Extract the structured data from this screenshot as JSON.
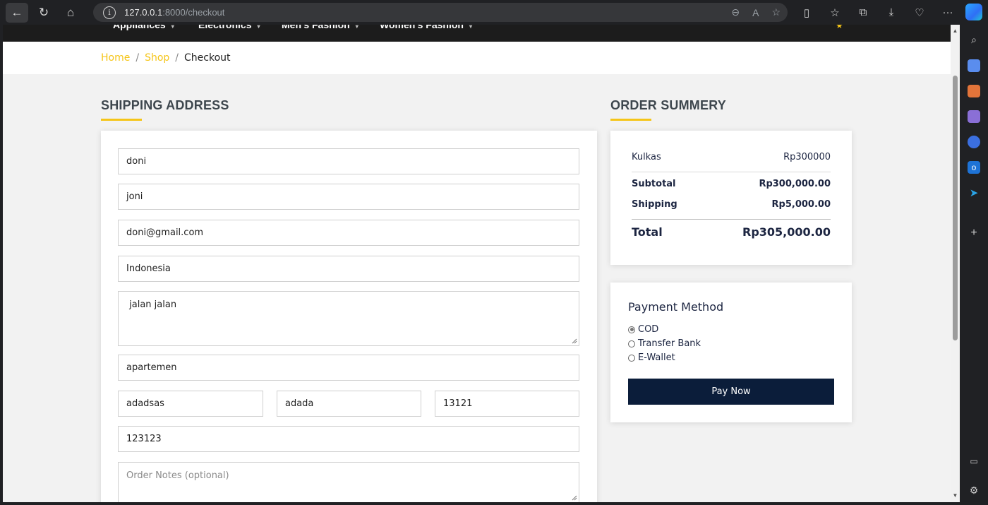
{
  "browser": {
    "url_host": "127.0.0.1",
    "url_rest": ":8000/checkout"
  },
  "nav": {
    "items": [
      "Appliances",
      "Electronics",
      "Men's Fashion",
      "Women's Fashion"
    ]
  },
  "breadcrumb": {
    "home": "Home",
    "shop": "Shop",
    "separator": "/",
    "current": "Checkout"
  },
  "shipping": {
    "title": "SHIPPING ADDRESS",
    "first_name": "doni",
    "last_name": "joni",
    "email": "doni@gmail.com",
    "country": "Indonesia",
    "address": " jalan jalan",
    "address2": "apartemen",
    "city": "adadsas",
    "state": "adada",
    "zip": "13121",
    "phone": "123123",
    "notes_placeholder": "Order Notes (optional)"
  },
  "summary": {
    "title": "ORDER SUMMERY",
    "item_name": "Kulkas",
    "item_price": "Rp300000",
    "subtotal_label": "Subtotal",
    "subtotal_value": "Rp300,000.00",
    "shipping_label": "Shipping",
    "shipping_value": "Rp5,000.00",
    "total_label": "Total",
    "total_value": "Rp305,000.00"
  },
  "payment": {
    "title": "Payment Method",
    "options": [
      "COD",
      "Transfer Bank",
      "E-Wallet"
    ],
    "selected": "COD",
    "button": "Pay Now"
  },
  "colors": {
    "accent": "#f5c518",
    "dark_button": "#0b1d3a",
    "navbar": "#1c1c1c"
  }
}
